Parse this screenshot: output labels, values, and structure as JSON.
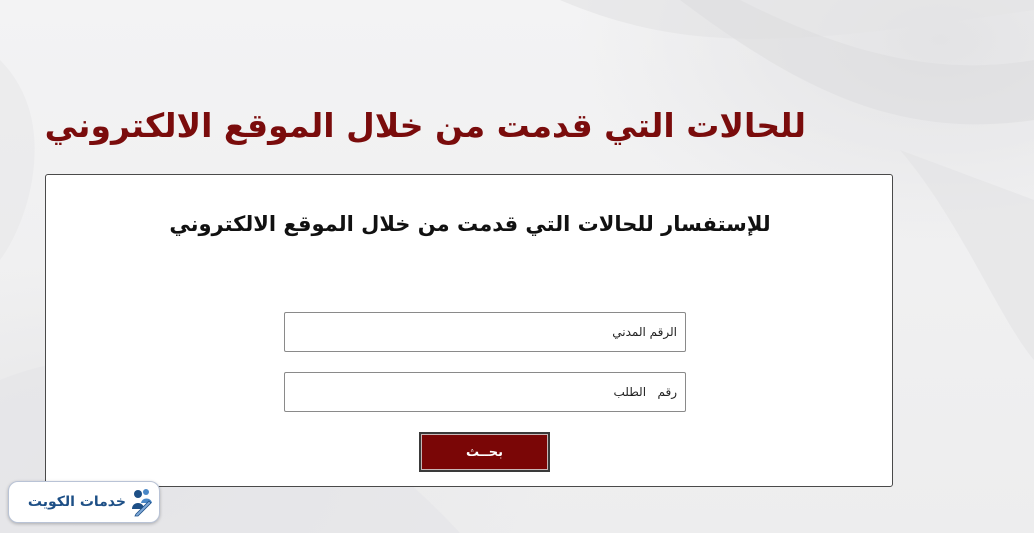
{
  "page": {
    "heading": "للحالات التي قدمت من خلال الموقع الالكتروني"
  },
  "form": {
    "title": "للإستفسار للحالات التي قدمت من خلال الموقع الالكتروني",
    "civil_id_placeholder": "الرقم المدني",
    "request_number_placeholder": "رقم   الطلب",
    "search_label": "بحــث"
  },
  "brand": {
    "name": "خدمات الكويت",
    "icon": "people-pen-logo-icon"
  },
  "colors": {
    "heading": "#7a0c0c",
    "button": "#7a0606",
    "brand": "#1d4f86"
  }
}
